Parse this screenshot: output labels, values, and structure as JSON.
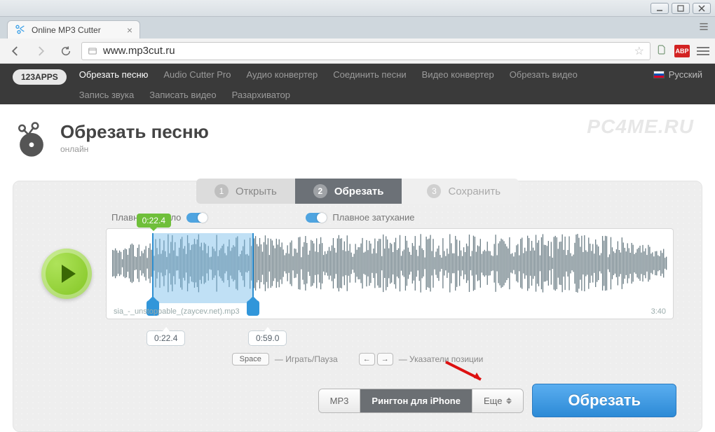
{
  "window": {
    "tab_title": "Online MP3 Cutter",
    "url": "www.mp3cut.ru"
  },
  "ext": {
    "abp_label": "ABP"
  },
  "site_nav": {
    "brand": "123APPS",
    "items": [
      {
        "label": "Обрезать песню",
        "active": true
      },
      {
        "label": "Audio Cutter Pro"
      },
      {
        "label": "Аудио конвертер"
      },
      {
        "label": "Соединить песни"
      },
      {
        "label": "Видео конвертер"
      },
      {
        "label": "Обрезать видео"
      },
      {
        "label": "Запись звука"
      },
      {
        "label": "Записать видео"
      },
      {
        "label": "Разархиватор"
      }
    ],
    "lang": "Русский"
  },
  "header": {
    "title": "Обрезать песню",
    "subtitle": "онлайн",
    "watermark": "PC4ME.RU"
  },
  "steps": {
    "s1": {
      "num": "1",
      "label": "Открыть"
    },
    "s2": {
      "num": "2",
      "label": "Обрезать"
    },
    "s3": {
      "num": "3",
      "label": "Сохранить"
    }
  },
  "toggles": {
    "fade_in": "Плавное начало",
    "fade_out": "Плавное затухание"
  },
  "track": {
    "filename": "sia_-_unstoppable_(zaycev.net).mp3",
    "duration": "3:40",
    "playhead": "0:22.4",
    "sel_start": "0:22.4",
    "sel_end": "0:59.0"
  },
  "hints": {
    "space_key": "Space",
    "space_label": "— Играть/Пауза",
    "arrow_left": "←",
    "arrow_right": "→",
    "arrows_label": "— Указатели позиции"
  },
  "format": {
    "mp3": "MP3",
    "iphone": "Рингтон для iPhone",
    "more": "Еще"
  },
  "cut_button": "Обрезать"
}
